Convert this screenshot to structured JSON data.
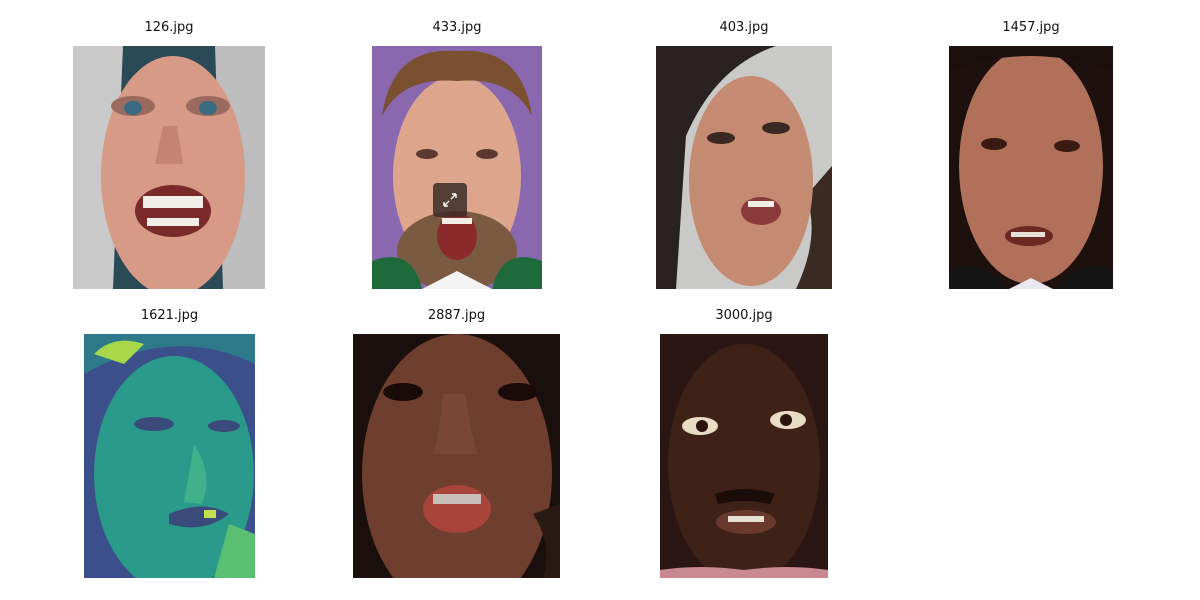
{
  "gallery": {
    "images": [
      {
        "filename": "126.jpg"
      },
      {
        "filename": "433.jpg"
      },
      {
        "filename": "403.jpg"
      },
      {
        "filename": "1457.jpg"
      },
      {
        "filename": "1621.jpg"
      },
      {
        "filename": "2887.jpg"
      },
      {
        "filename": "3000.jpg"
      }
    ],
    "expand_icon": "expand-arrows-icon"
  }
}
